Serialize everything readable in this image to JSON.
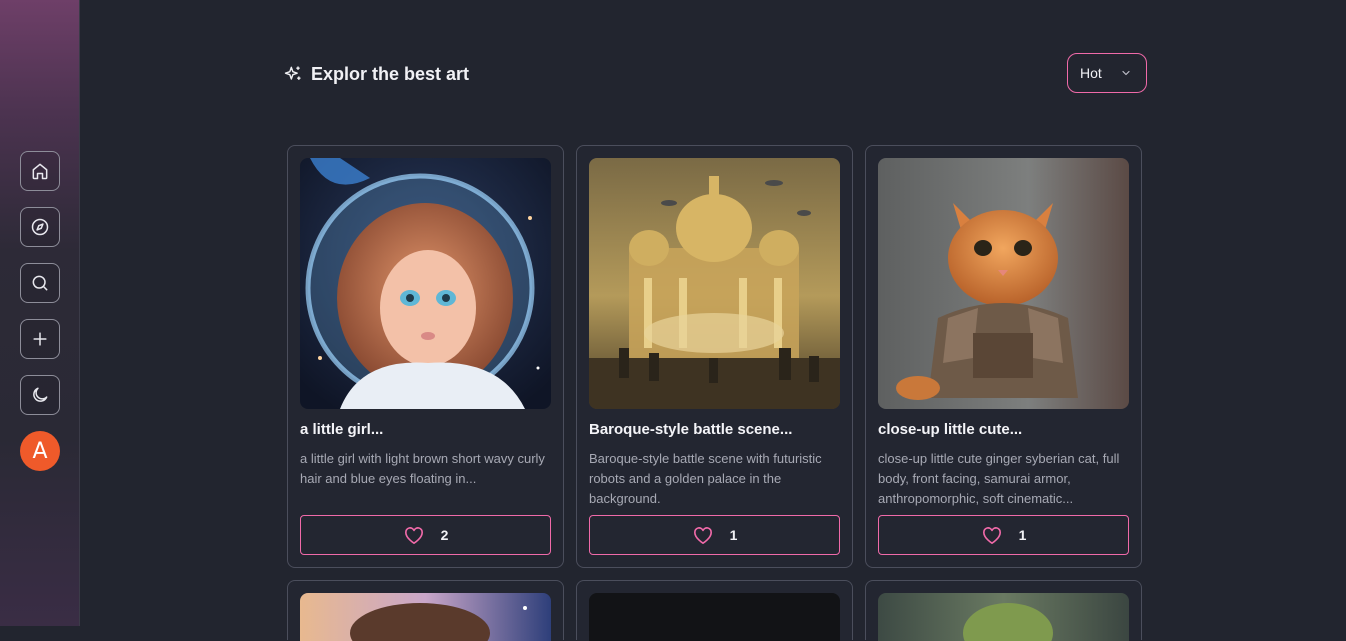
{
  "sidebar": {
    "items": [
      {
        "icon": "home-icon"
      },
      {
        "icon": "compass-icon"
      },
      {
        "icon": "search-icon"
      },
      {
        "icon": "plus-icon"
      },
      {
        "icon": "moon-icon"
      }
    ],
    "avatar_initial": "A",
    "avatar_color": "#ef5a2a"
  },
  "header": {
    "icon": "sparkles-icon",
    "title": "Explor the best art"
  },
  "sort": {
    "selected": "Hot",
    "icon": "chevron-down-icon"
  },
  "colors": {
    "accent": "#f06aa9",
    "background": "#22252f"
  },
  "cards": [
    {
      "title": "a little girl...",
      "description": "a little girl with light brown short wavy curly hair and blue eyes floating in...",
      "likes": "2"
    },
    {
      "title": "Baroque-style battle scene...",
      "description": "Baroque-style battle scene with futuristic robots and a golden palace in the background.",
      "likes": "1"
    },
    {
      "title": "close-up little cute...",
      "description": "close-up little cute ginger syberian cat, full body, front facing, samurai armor, anthropomorphic, soft cinematic...",
      "likes": "1"
    }
  ]
}
